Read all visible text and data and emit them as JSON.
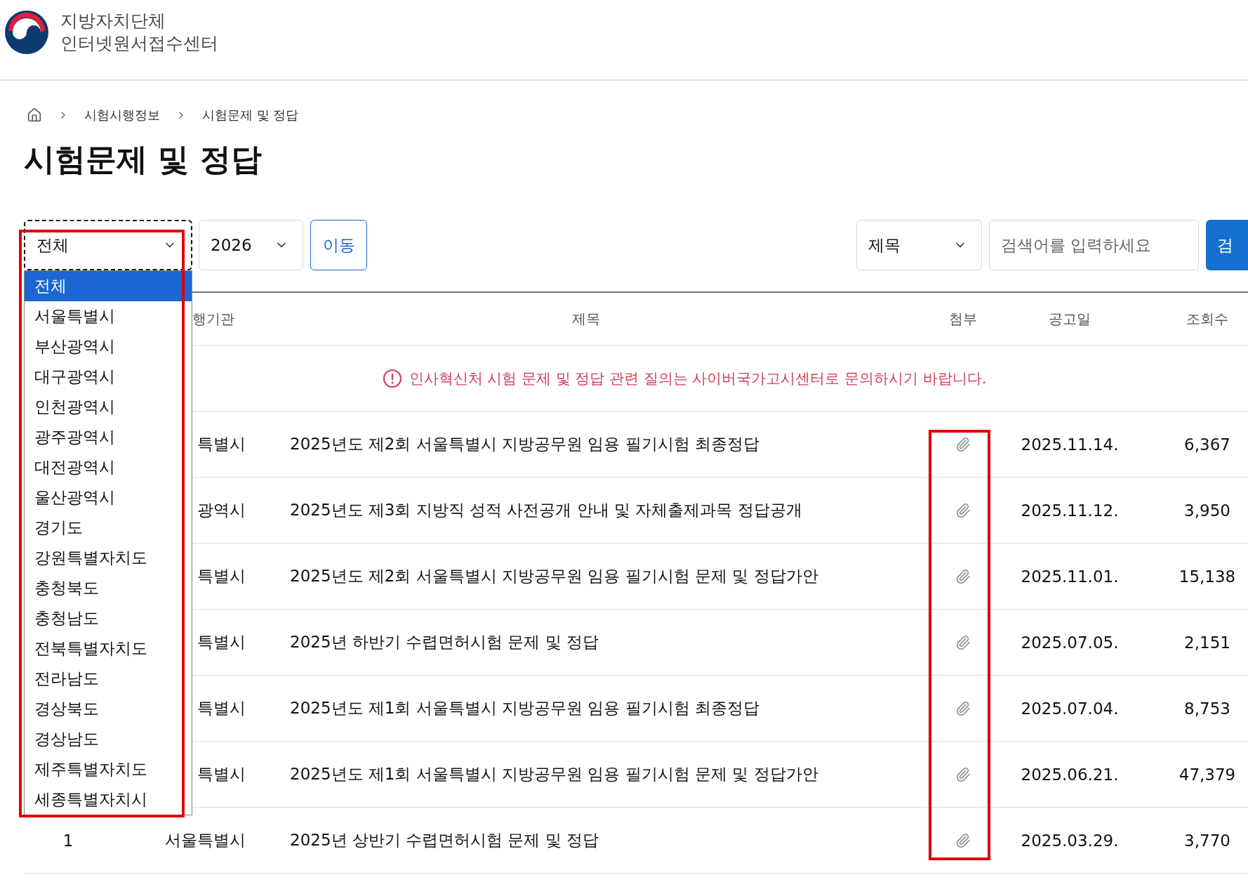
{
  "header": {
    "logo_line1": "지방자치단체",
    "logo_line2": "인터넷원서접수센터"
  },
  "breadcrumb": [
    "시험시행정보",
    "시험문제 및 정답"
  ],
  "page_title": "시험문제 및 정답",
  "filters": {
    "region": {
      "value": "전체",
      "expanded": true,
      "highlighted": true,
      "options": [
        {
          "label": "전체",
          "selected": true
        },
        {
          "label": "서울특별시",
          "selected": false
        },
        {
          "label": "부산광역시",
          "selected": false
        },
        {
          "label": "대구광역시",
          "selected": false
        },
        {
          "label": "인천광역시",
          "selected": false
        },
        {
          "label": "광주광역시",
          "selected": false
        },
        {
          "label": "대전광역시",
          "selected": false
        },
        {
          "label": "울산광역시",
          "selected": false
        },
        {
          "label": "경기도",
          "selected": false
        },
        {
          "label": "강원특별자치도",
          "selected": false
        },
        {
          "label": "충청북도",
          "selected": false
        },
        {
          "label": "충청남도",
          "selected": false
        },
        {
          "label": "전북특별자치도",
          "selected": false
        },
        {
          "label": "전라남도",
          "selected": false
        },
        {
          "label": "경상북도",
          "selected": false
        },
        {
          "label": "경상남도",
          "selected": false
        },
        {
          "label": "제주특별자치도",
          "selected": false
        },
        {
          "label": "세종특별자치시",
          "selected": false
        }
      ]
    },
    "year": {
      "value": "2026"
    },
    "go_button": "이동",
    "search_type": {
      "value": "제목"
    },
    "search": {
      "placeholder": "검색어를 입력하세요"
    },
    "search_button": "검"
  },
  "table": {
    "columns": [
      "행기관",
      "제목",
      "첨부",
      "공고일",
      "조회수"
    ],
    "attachments_highlighted": true,
    "notice": "인사혁신처 시험 문제 및 정답 관련 질의는 사이버국가고시센터로 문의하시기 바랍니다.",
    "rows": [
      {
        "org": "특별시",
        "title": "2025년도 제2회 서울특별시 지방공무원 임용 필기시험 최종정답",
        "attachment": true,
        "date": "2025.11.14.",
        "views": "6,367"
      },
      {
        "org": "광역시",
        "title": "2025년도 제3회 지방직 성적 사전공개 안내 및 자체출제과목 정답공개",
        "attachment": true,
        "date": "2025.11.12.",
        "views": "3,950"
      },
      {
        "org": "특별시",
        "title": "2025년도 제2회 서울특별시 지방공무원 임용 필기시험 문제 및 정답가안",
        "attachment": true,
        "date": "2025.11.01.",
        "views": "15,138"
      },
      {
        "org": "특별시",
        "title": "2025년 하반기 수렵면허시험 문제 및 정답",
        "attachment": true,
        "date": "2025.07.05.",
        "views": "2,151"
      },
      {
        "org": "특별시",
        "title": "2025년도 제1회 서울특별시 지방공무원 임용 필기시험 최종정답",
        "attachment": true,
        "date": "2025.07.04.",
        "views": "8,753"
      },
      {
        "org": "특별시",
        "title": "2025년도 제1회 서울특별시 지방공무원 임용 필기시험 문제 및 정답가안",
        "attachment": true,
        "date": "2025.06.21.",
        "views": "47,379"
      },
      {
        "number": "1",
        "org": "서울특별시",
        "title": "2025년 상반기 수렵면허시험 문제 및 정답",
        "attachment": true,
        "date": "2025.03.29.",
        "views": "3,770"
      }
    ]
  }
}
